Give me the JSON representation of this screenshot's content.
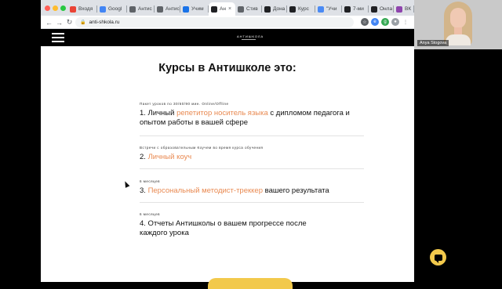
{
  "browser": {
    "tabs": [
      {
        "label": "Входя",
        "icon": "gmail-icon",
        "color": "#ea4335"
      },
      {
        "label": "Googl",
        "icon": "google-docs-icon",
        "color": "#4285f4"
      },
      {
        "label": "Антис",
        "icon": "link-icon",
        "color": "#5f6368"
      },
      {
        "label": "Антис",
        "icon": "globe-icon",
        "color": "#5f6368"
      },
      {
        "label": "Учим",
        "icon": "c-icon",
        "color": "#1a73e8"
      },
      {
        "label": "Ан",
        "icon": "a-icon",
        "color": "#202124",
        "active": true
      },
      {
        "label": "Стив",
        "icon": "link-icon",
        "color": "#5f6368"
      },
      {
        "label": "Дона",
        "icon": "a-icon",
        "color": "#202124"
      },
      {
        "label": "Курс",
        "icon": "a-icon",
        "color": "#202124"
      },
      {
        "label": "\"Учи",
        "icon": "globe-icon",
        "color": "#4a8af4"
      },
      {
        "label": "7-ми",
        "icon": "a-icon",
        "color": "#202124"
      },
      {
        "label": "Онла",
        "icon": "a-icon",
        "color": "#202124"
      },
      {
        "label": "ВК",
        "icon": "b-icon",
        "color": "#8e44ad"
      }
    ],
    "active_tab_close": "×",
    "url": "anti-shkola.ru",
    "back": "←",
    "forward": "→",
    "reload": "↻"
  },
  "site": {
    "logo": "АНТИШКОЛА",
    "title": "Курсы в Антишколе это:",
    "items": [
      {
        "caption": "Пакет уроков по 30/60/90 мин. Online/Offline",
        "prefix": "1. Личный ",
        "highlight": "репетитор носитель языка",
        "suffix": " с дипломом педагога и опытом работы в вашей сфере"
      },
      {
        "caption": "Встречи с образовательным Коучем во время курса обучения",
        "prefix": "2. ",
        "highlight": "Личный коуч",
        "suffix": ""
      },
      {
        "caption": "6 месяцев",
        "prefix": "3. ",
        "highlight": "Персональный методист-треккер",
        "suffix": " вашего результата"
      },
      {
        "caption": "6 месяцев",
        "prefix": "4. Отчеты Антишколы о вашем прогрессе после каждого урока",
        "highlight": "",
        "suffix": ""
      }
    ]
  },
  "video": {
    "name": "Anya Stogova"
  },
  "colors": {
    "accent": "#e98a52",
    "cta": "#f2c94c",
    "header": "#000000"
  }
}
